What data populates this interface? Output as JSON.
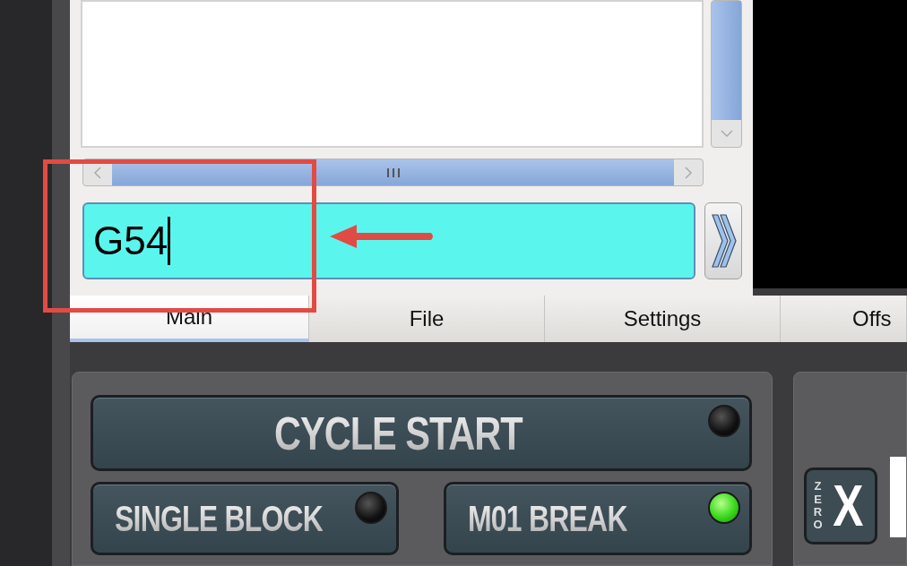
{
  "mdi": {
    "value": "G54"
  },
  "tabs": [
    {
      "label": "Main",
      "selected": true
    },
    {
      "label": "File",
      "selected": false
    },
    {
      "label": "Settings",
      "selected": false
    },
    {
      "label": "Offs",
      "selected": false
    }
  ],
  "cycle_buttons": [
    {
      "label": "CYCLE START",
      "led_on": false
    },
    {
      "label": "SINGLE BLOCK",
      "led_on": false
    },
    {
      "label": "M01 BREAK",
      "led_on": true
    }
  ],
  "axis_zero": {
    "zero_label": "ZERO",
    "axis": "X"
  }
}
